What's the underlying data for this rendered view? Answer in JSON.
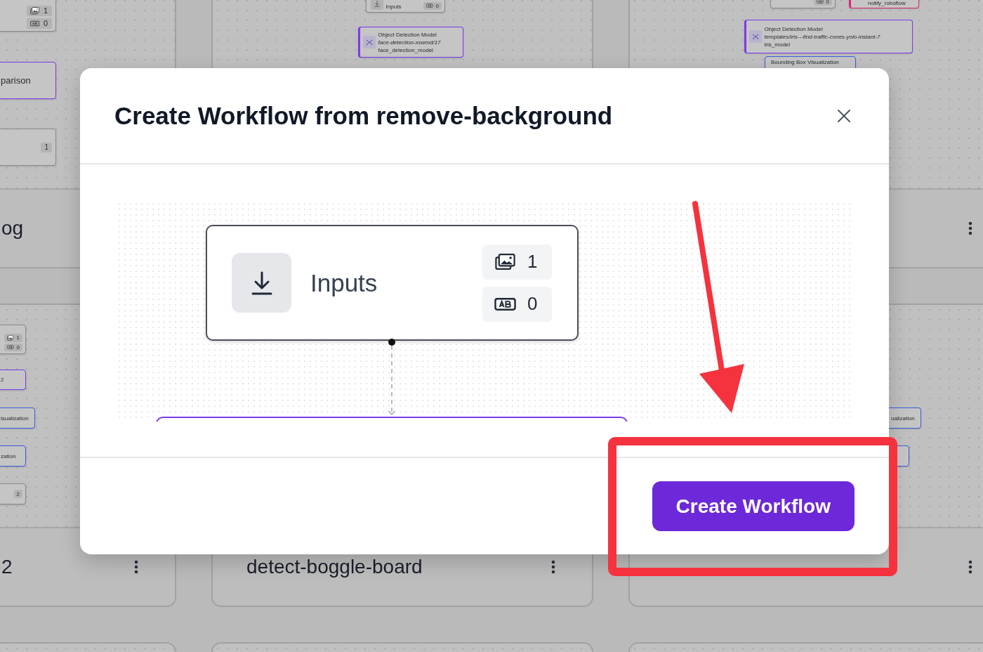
{
  "cards": [
    {
      "title": "og",
      "title_clipped": true,
      "nodes": [
        {
          "kind": "inputs",
          "image_count": "1",
          "text_count": "0",
          "color": "#8a8a8a"
        },
        {
          "kind": "label",
          "text": "parison",
          "color": "#7c3aed"
        },
        {
          "kind": "count",
          "count": "1",
          "color": "#8a8a8a"
        }
      ]
    },
    {
      "nodes": [
        {
          "kind": "inputs",
          "title": "Inputs",
          "text_count": "0",
          "color": "#8a8a8a"
        },
        {
          "kind": "model",
          "title": "Object Detection Model",
          "lines": [
            "face-detection-xswmd/17",
            "face_detection_model"
          ],
          "color": "#7c3aed"
        }
      ]
    },
    {
      "has_menu": true,
      "nodes": [
        {
          "kind": "inputs",
          "text_count": "0",
          "color": "#8a8a8a"
        },
        {
          "kind": "sink",
          "lines": [
            "notify_roboflow"
          ],
          "color": "#db2777"
        },
        {
          "kind": "model",
          "title": "Object Detection Model",
          "lines": [
            "templates/iris---find-traffic-cones-yolo-instant-7",
            "iris_model"
          ],
          "color": "#7c3aed"
        },
        {
          "kind": "label",
          "text": "Bounding Box Visualization",
          "color": "#3b5bdb"
        }
      ]
    },
    {
      "title": "2",
      "title_clipped": true,
      "has_menu": true,
      "nodes": [
        {
          "kind": "inputs",
          "image_count": "1",
          "text_count": "0",
          "color": "#8a8a8a"
        },
        {
          "kind": "label",
          "text": "2",
          "color": "#7c3aed"
        },
        {
          "kind": "label",
          "text": "isualization",
          "color": "#3b5bdb"
        },
        {
          "kind": "label",
          "text": "zation",
          "color": "#3b5bdb"
        },
        {
          "kind": "count",
          "count": "2",
          "color": "#8a8a8a"
        }
      ]
    },
    {
      "title": "detect-boggle-board",
      "has_menu": true
    },
    {
      "has_menu": true,
      "nodes": [
        {
          "kind": "label",
          "text": "ualization",
          "color": "#3b5bdb"
        },
        {
          "kind": "label",
          "color": "#3b5bdb"
        }
      ]
    }
  ],
  "modal": {
    "title": "Create Workflow from remove-background",
    "preview": {
      "nodes": [
        {
          "kind": "inputs",
          "title": "Inputs",
          "image_count": "1",
          "text_count": "0"
        },
        {
          "kind": "block",
          "color": "#7c3aed"
        }
      ]
    },
    "button": "Create Workflow"
  },
  "annotations": {
    "arrow": {
      "color": "#f6323e"
    },
    "frame": {
      "color": "#f6323e"
    }
  }
}
